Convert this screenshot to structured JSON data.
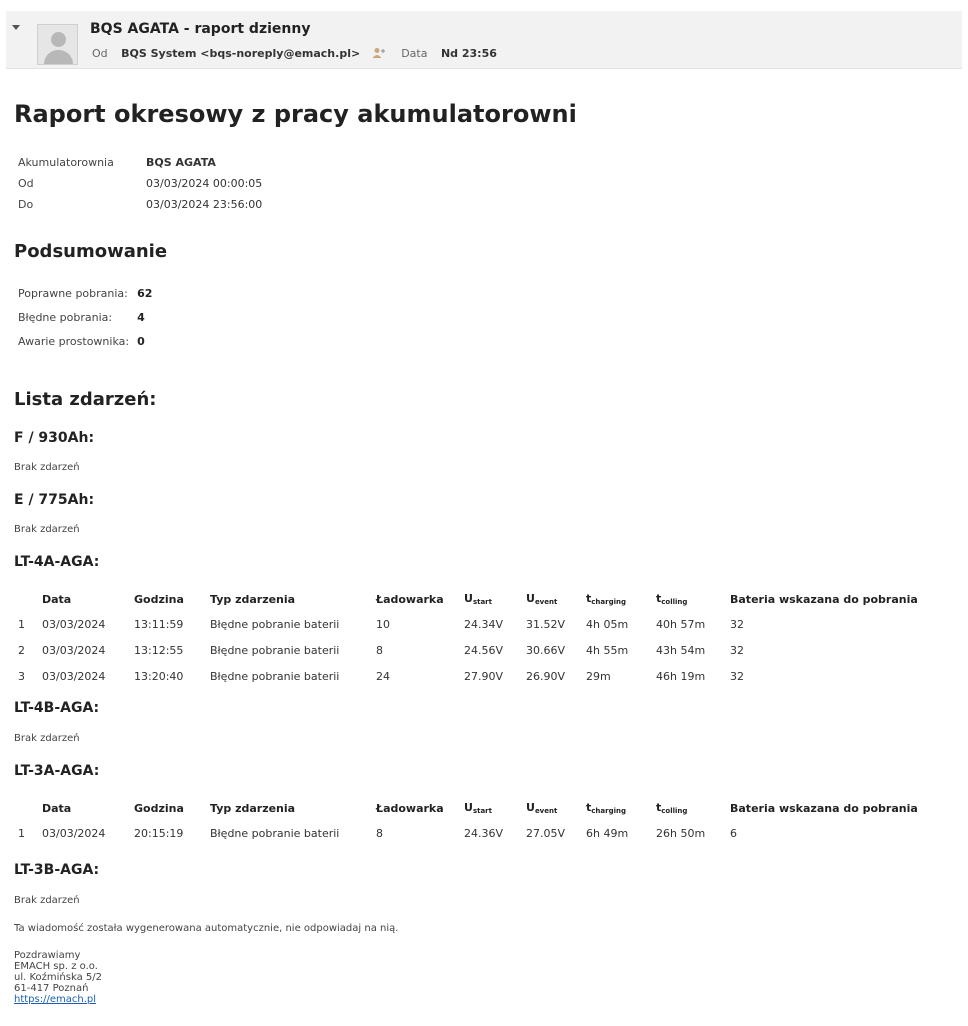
{
  "header": {
    "subject": "BQS AGATA - raport dzienny",
    "from_label": "Od",
    "from_value": "BQS System <bqs-noreply@emach.pl>",
    "date_label": "Data",
    "date_value": "Nd 23:56"
  },
  "report": {
    "title": "Raport okresowy z pracy akumulatorowni",
    "info": [
      {
        "label": "Akumulatorownia",
        "value": "BQS AGATA"
      },
      {
        "label": "Od",
        "value": "03/03/2024 00:00:05"
      },
      {
        "label": "Do",
        "value": "03/03/2024 23:56:00"
      }
    ],
    "summary_title": "Podsumowanie",
    "summary": [
      {
        "label": "Poprawne pobrania:",
        "value": "62"
      },
      {
        "label": "Błędne pobrania:",
        "value": "4"
      },
      {
        "label": "Awarie prostownika:",
        "value": "0"
      }
    ],
    "events_title": "Lista zdarzeń:",
    "no_events_text": "Brak zdarzeń",
    "table_headers": {
      "date": "Data",
      "time": "Godzina",
      "type": "Typ zdarzenia",
      "charger": "Ładowarka",
      "u": "U",
      "u_start_sub": "start",
      "u_event_sub": "event",
      "t": "t",
      "t_charging_sub": "charging",
      "t_colling_sub": "colling",
      "battery": "Bateria wskazana do pobrania"
    },
    "groups": [
      {
        "name": "F / 930Ah:"
      },
      {
        "name": "E / 775Ah:"
      },
      {
        "name": "LT-4A-AGA:",
        "rows": [
          {
            "n": "1",
            "date": "03/03/2024",
            "time": "13:11:59",
            "type": "Błędne pobranie baterii",
            "charger": "10",
            "u_start": "24.34V",
            "u_event": "31.52V",
            "t_charging": "4h 05m",
            "t_colling": "40h 57m",
            "battery": "32"
          },
          {
            "n": "2",
            "date": "03/03/2024",
            "time": "13:12:55",
            "type": "Błędne pobranie baterii",
            "charger": "8",
            "u_start": "24.56V",
            "u_event": "30.66V",
            "t_charging": "4h 55m",
            "t_colling": "43h 54m",
            "battery": "32"
          },
          {
            "n": "3",
            "date": "03/03/2024",
            "time": "13:20:40",
            "type": "Błędne pobranie baterii",
            "charger": "24",
            "u_start": "27.90V",
            "u_event": "26.90V",
            "t_charging": "29m",
            "t_colling": "46h 19m",
            "battery": "32"
          }
        ]
      },
      {
        "name": "LT-4B-AGA:"
      },
      {
        "name": "LT-3A-AGA:",
        "rows": [
          {
            "n": "1",
            "date": "03/03/2024",
            "time": "20:15:19",
            "type": "Błędne pobranie baterii",
            "charger": "8",
            "u_start": "24.36V",
            "u_event": "27.05V",
            "t_charging": "6h 49m",
            "t_colling": "26h 50m",
            "battery": "6"
          }
        ]
      },
      {
        "name": "LT-3B-AGA:"
      }
    ],
    "auto_note": "Ta wiadomość została wygenerowana automatycznie, nie odpowiadaj na nią.",
    "signature": {
      "greeting": "Pozdrawiamy",
      "company": "EMACH sp. z o.o.",
      "street": "ul. Koźmińska 5/2",
      "city": "61-417 Poznań",
      "url": "https://emach.pl"
    }
  }
}
